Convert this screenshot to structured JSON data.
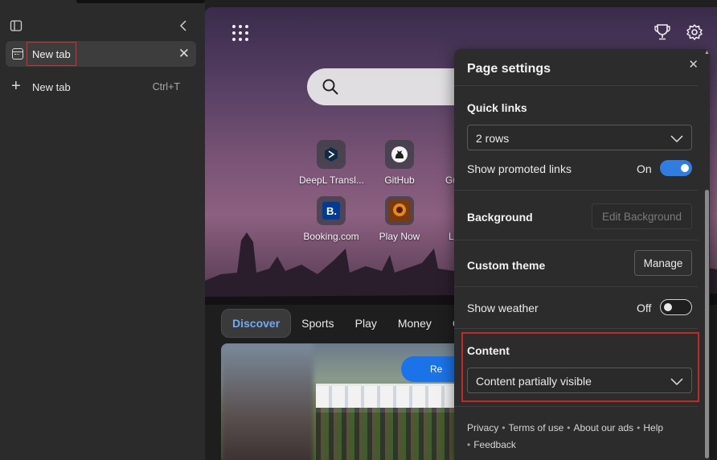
{
  "sidebar": {
    "active_tab": {
      "title": "New tab"
    },
    "new_tab": {
      "label": "New tab",
      "shortcut": "Ctrl+T"
    }
  },
  "new_tab_page": {
    "quick_links": [
      {
        "name": "DeepL Transl...",
        "icon": "deepl-icon"
      },
      {
        "name": "GitHub",
        "icon": "github-icon"
      },
      {
        "name": "Gu",
        "icon": "partial-icon"
      },
      {
        "name": "Booking.com",
        "icon": "booking-icon"
      },
      {
        "name": "Play Now",
        "icon": "game-icon"
      },
      {
        "name": "L",
        "icon": "partial-icon"
      }
    ],
    "feed_tabs": [
      "Discover",
      "Sports",
      "Play",
      "Money",
      "G"
    ],
    "refresh_chip": "Re"
  },
  "page_settings": {
    "title": "Page settings",
    "quick_links": {
      "heading": "Quick links",
      "rows_value": "2 rows",
      "promoted_label": "Show promoted links",
      "promoted_state": "On"
    },
    "background": {
      "heading": "Background",
      "edit_button": "Edit Background"
    },
    "custom_theme": {
      "heading": "Custom theme",
      "manage_button": "Manage"
    },
    "weather": {
      "label": "Show weather",
      "state": "Off"
    },
    "content": {
      "heading": "Content",
      "value": "Content partially visible"
    },
    "footer": {
      "privacy": "Privacy",
      "terms": "Terms of use",
      "ads": "About our ads",
      "help": "Help",
      "feedback": "Feedback"
    }
  },
  "colors": {
    "accent": "#2f7de1",
    "highlight_border": "#c62828",
    "active_feed_tab": "#70aaf4"
  }
}
